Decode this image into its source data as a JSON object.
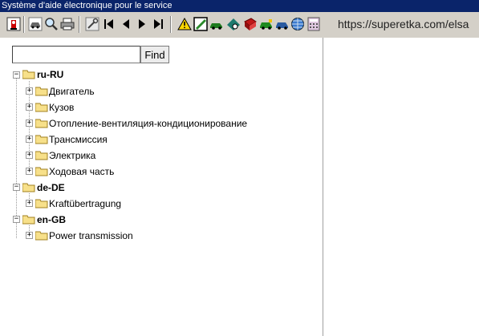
{
  "window": {
    "title": "Système d'aide électronique pour le service"
  },
  "toolbar": {
    "buttons": [
      {
        "icon": "exit-icon"
      },
      {
        "icon": "vehicle-icon"
      },
      {
        "icon": "search-icon"
      },
      {
        "icon": "print-icon"
      },
      {
        "icon": "tools-icon"
      },
      {
        "icon": "first-page-icon"
      },
      {
        "icon": "previous-page-icon"
      },
      {
        "icon": "next-page-icon"
      },
      {
        "icon": "last-page-icon"
      },
      {
        "icon": "warning-icon"
      },
      {
        "icon": "repair-manual-icon"
      },
      {
        "icon": "car-info-icon"
      },
      {
        "icon": "car-diagnostic-icon"
      },
      {
        "icon": "book-icon"
      },
      {
        "icon": "car-service-icon"
      },
      {
        "icon": "car-parts-icon"
      },
      {
        "icon": "globe-icon"
      },
      {
        "icon": "calculator-icon"
      }
    ],
    "url": "https://superetka.com/elsa"
  },
  "search": {
    "value": "",
    "button_label": "Find"
  },
  "tree": [
    {
      "label": "ru-RU",
      "children": [
        "Двигатель",
        "Кузов",
        "Отопление-вентиляция-кондиционирование",
        "Трансмиссия",
        "Электрика",
        "Ходовая часть"
      ]
    },
    {
      "label": "de-DE",
      "children": [
        "Kraftübertragung"
      ]
    },
    {
      "label": "en-GB",
      "children": [
        "Power transmission"
      ]
    }
  ]
}
